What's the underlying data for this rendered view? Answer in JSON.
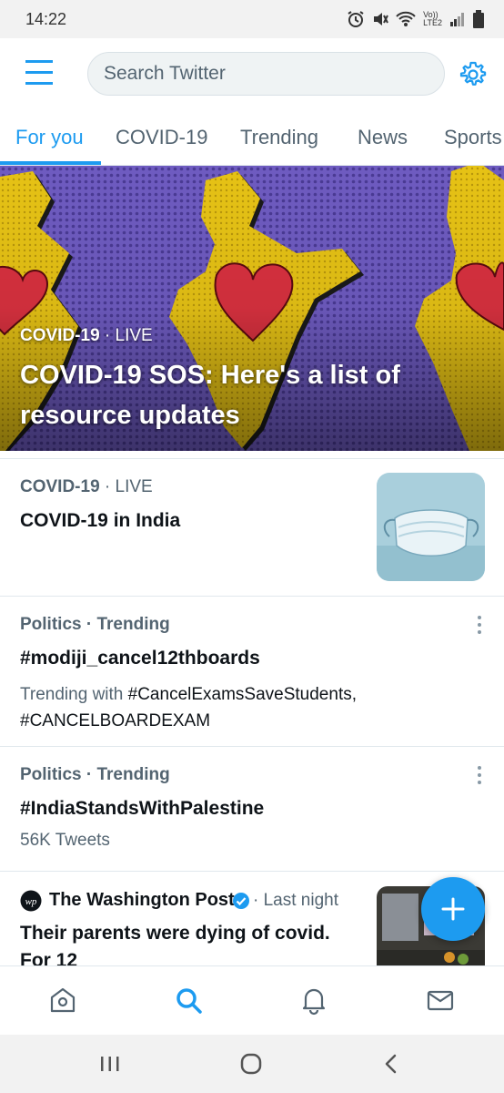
{
  "status_bar": {
    "time": "14:22",
    "icons": [
      "alarm-icon",
      "mute-icon",
      "wifi-icon",
      "volte-icon",
      "signal-icon",
      "battery-icon"
    ],
    "volte_line1": "Vo))",
    "volte_line2": "LTE2"
  },
  "header": {
    "search_placeholder": "Search Twitter",
    "menu_icon": "hamburger-icon",
    "settings_icon": "gear-icon"
  },
  "tabs": [
    {
      "label": "For you",
      "active": true
    },
    {
      "label": "COVID-19",
      "active": false
    },
    {
      "label": "Trending",
      "active": false
    },
    {
      "label": "News",
      "active": false
    },
    {
      "label": "Sports",
      "active": false
    }
  ],
  "hero": {
    "category": "COVID-19",
    "status": "· LIVE",
    "title": "COVID-19 SOS: Here's a list of resource updates"
  },
  "items": [
    {
      "category": "COVID-19",
      "status": "· LIVE",
      "title": "COVID-19 in India"
    },
    {
      "category": "Politics · Trending",
      "title": "#modiji_cancel12thboards",
      "sub_prefix": "Trending with ",
      "sub_tag1": "#CancelExamsSaveStudents,",
      "sub_tag2": "#CANCELBOARDEXAM"
    },
    {
      "category": "Politics · Trending",
      "title": "#IndiaStandsWithPalestine",
      "sub": "56K Tweets"
    },
    {
      "source": "The Washington Post",
      "time": "· Last night",
      "title_line1": "Their parents were dying of covid.",
      "title_line2": "For 12"
    }
  ],
  "bottom_nav": [
    "home-icon",
    "search-icon",
    "notifications-icon",
    "messages-icon"
  ],
  "colors": {
    "accent": "#1d9bf0",
    "text_primary": "#0f1419",
    "text_secondary": "#536471",
    "hero_bg": "#6a55b8",
    "map_yellow": "#e8c41a",
    "heart_red": "#d8313f"
  }
}
